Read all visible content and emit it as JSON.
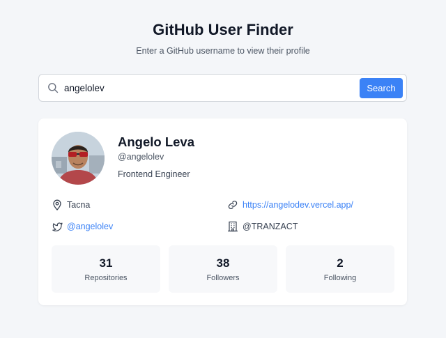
{
  "header": {
    "title": "GitHub User Finder",
    "subtitle": "Enter a GitHub username to view their profile"
  },
  "search": {
    "value": "angelolev",
    "button_label": "Search",
    "icon": "search-icon"
  },
  "profile": {
    "name": "Angelo Leva",
    "handle": "@angelolev",
    "bio": "Frontend Engineer",
    "location": "Tacna",
    "website": "https://angelodev.vercel.app/",
    "twitter": "@angelolev",
    "company": "@TRANZACT"
  },
  "stats": [
    {
      "value": "31",
      "label": "Repositories"
    },
    {
      "value": "38",
      "label": "Followers"
    },
    {
      "value": "2",
      "label": "Following"
    }
  ],
  "colors": {
    "accent": "#3b82f6",
    "background": "#f4f6f9",
    "card": "#ffffff",
    "stat_box": "#f7f8fa"
  }
}
